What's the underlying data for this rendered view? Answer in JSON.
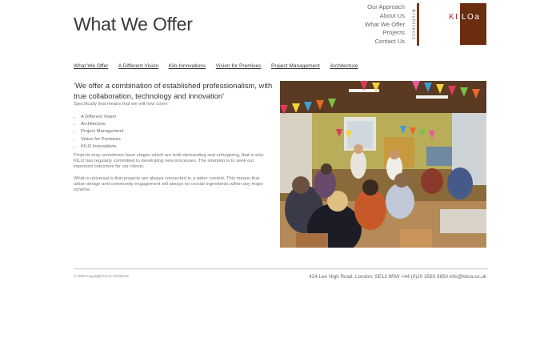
{
  "header": {
    "title": "What We Offer",
    "nav": [
      "Our Approach",
      "About Us",
      "What We Offer",
      "Projects",
      "Contact Us"
    ],
    "architects_label": "Architects",
    "logo": {
      "part1": "KI",
      "part2": "LOa"
    }
  },
  "subnav": [
    "What We Offer",
    "A Different Vision",
    "Kilo Innovations",
    "Vision for Premises",
    "Project Management",
    "Architecture"
  ],
  "content": {
    "quote": "‘We offer a combination of established professionalism, with true collaboration, technology and innovation’",
    "intro": "Specifically that means that we will now cover:",
    "services": [
      "A Different Vision",
      "Architecture",
      "Project Management",
      "Vision for Premises",
      "KILO Innovations"
    ],
    "paragraph1": "Projects may sometimes have stages which are both demanding and unforgiving, that is why KILO has regularly committed to developing new processes. The intention is to seek out improved outcomes for our clients.",
    "paragraph2": "What is universal is that projects are always connected to a wider context. This means that urban design and community engagement will always be crucial ingredients within any major scheme."
  },
  "footer": {
    "copyright": "© 2020 Copyright KILO Architects",
    "address": "424 Lee High Road, London, SE12 8RW +44 (0)20 3583 9850 info@kiloa.co.uk"
  },
  "colors": {
    "accent": "#c0192e",
    "brand": "#6b2d10",
    "text": "#3f3a36"
  }
}
